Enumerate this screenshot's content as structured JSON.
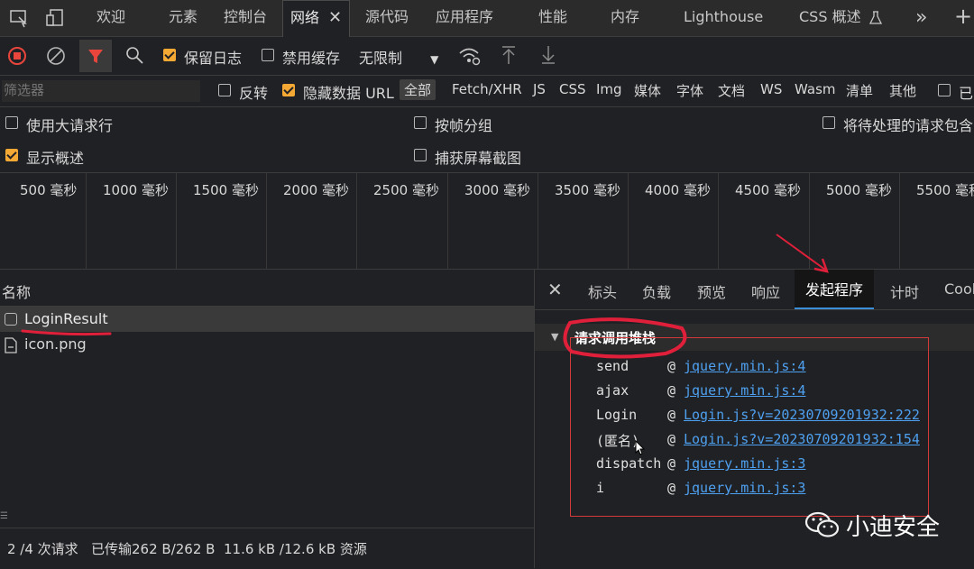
{
  "tabs": [
    "欢迎",
    "元素",
    "控制台",
    "网络",
    "源代码",
    "应用程序",
    "性能",
    "内存",
    "Lighthouse",
    "CSS 概述"
  ],
  "active_tab_close": "✕",
  "toolbar": {
    "preserve_log": "保留日志",
    "disable_cache": "禁用缓存",
    "throttle": "无限制"
  },
  "filter": {
    "placeholder": "筛选器",
    "invert": "反转",
    "hide_data_urls": "隐藏数据 URL",
    "types": [
      "全部",
      "Fetch/XHR",
      "JS",
      "CSS",
      "Img",
      "媒体",
      "字体",
      "文档",
      "WS",
      "Wasm",
      "清单",
      "其他"
    ],
    "extra": "已"
  },
  "options": {
    "big_rows": "使用大请求行",
    "group_by_frame": "按帧分组",
    "pending_requests": "将待处理的请求包含",
    "show_overview": "显示概述",
    "capture_screenshots": "捕获屏幕截图"
  },
  "timeline_ticks": [
    "500 毫秒",
    "1000 毫秒",
    "1500 毫秒",
    "2000 毫秒",
    "2500 毫秒",
    "3000 毫秒",
    "3500 毫秒",
    "4000 毫秒",
    "4500 毫秒",
    "5000 毫秒",
    "5500 毫秒"
  ],
  "request_list": {
    "header": "名称",
    "rows": [
      "LoginResult",
      "icon.png"
    ]
  },
  "status": {
    "requests": "2 /4 次请求",
    "transferred": "已传输262 B/262 B",
    "resources": "11.6 kB /12.6 kB 资源"
  },
  "detail_tabs": [
    "标头",
    "负载",
    "预览",
    "响应",
    "发起程序",
    "计时",
    "Cook"
  ],
  "call_stack": {
    "title": "请求调用堆栈",
    "frames": [
      {
        "fn": "send",
        "at": "@",
        "loc": "jquery.min.js:4"
      },
      {
        "fn": "ajax",
        "at": "@",
        "loc": "jquery.min.js:4"
      },
      {
        "fn": "Login",
        "at": "@",
        "loc": "Login.js?v=20230709201932:222"
      },
      {
        "fn": "(匿名)",
        "at": "@",
        "loc": "Login.js?v=20230709201932:154"
      },
      {
        "fn": "dispatch",
        "at": "@",
        "loc": "jquery.min.js:3"
      },
      {
        "fn": "i",
        "at": "@",
        "loc": "jquery.min.js:3"
      }
    ]
  },
  "watermark": "小迪安全",
  "colors": {
    "accent_orange": "#f4a935",
    "link_blue": "#4ea0f0",
    "annotation_red": "#e0203a",
    "record_red": "#e8453c"
  }
}
